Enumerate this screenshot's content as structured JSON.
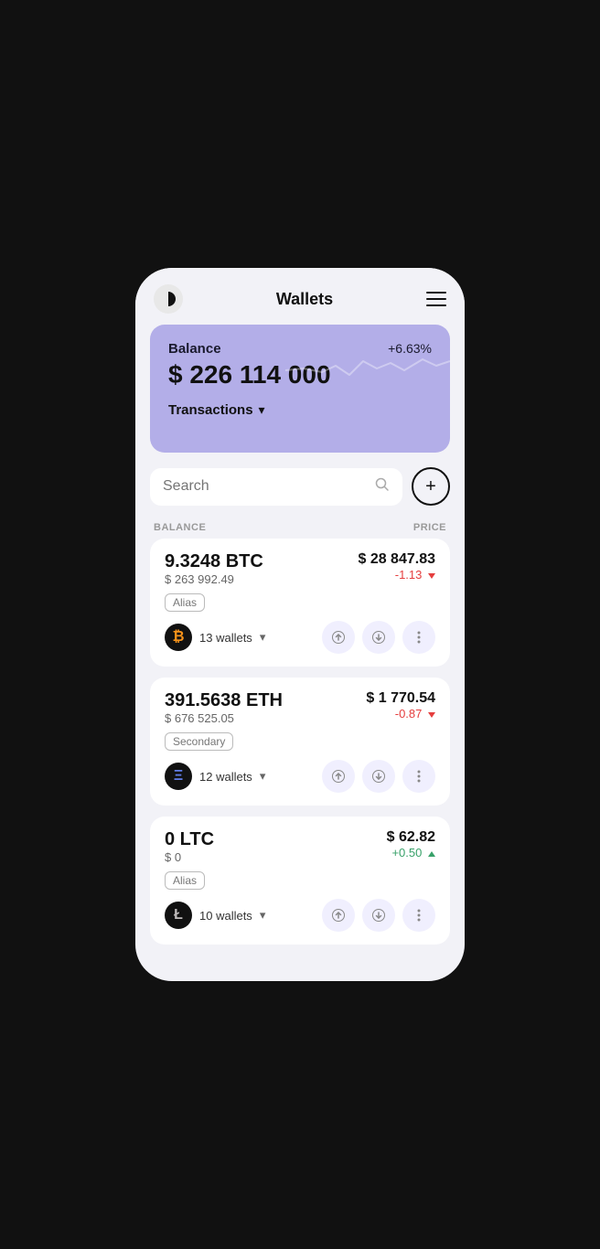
{
  "app": {
    "title": "Wallets"
  },
  "header": {
    "menu_label": "menu"
  },
  "balance_card": {
    "label": "Balance",
    "percent": "+6.63%",
    "amount": "$ 226 114 000",
    "transactions_label": "Transactions"
  },
  "search": {
    "placeholder": "Search"
  },
  "columns": {
    "balance": "BALANCE",
    "price": "PRICE"
  },
  "assets": [
    {
      "id": "btc",
      "amount": "9.3248 BTC",
      "usd": "$ 263 992.49",
      "tag": "Alias",
      "price": "$ 28 847.83",
      "change": "-1.13",
      "change_type": "negative",
      "wallets": "13 wallets",
      "coin_symbol": "₿"
    },
    {
      "id": "eth",
      "amount": "391.5638 ETH",
      "usd": "$ 676 525.05",
      "tag": "Secondary",
      "price": "$ 1 770.54",
      "change": "-0.87",
      "change_type": "negative",
      "wallets": "12 wallets",
      "coin_symbol": "Ξ"
    },
    {
      "id": "ltc",
      "amount": "0 LTC",
      "usd": "$ 0",
      "tag": "Alias",
      "price": "$ 62.82",
      "change": "+0.50",
      "change_type": "positive",
      "wallets": "10 wallets",
      "coin_symbol": "Ł"
    }
  ],
  "buttons": {
    "send": "↑",
    "receive": "↓",
    "more": "⋮",
    "add": "+"
  }
}
